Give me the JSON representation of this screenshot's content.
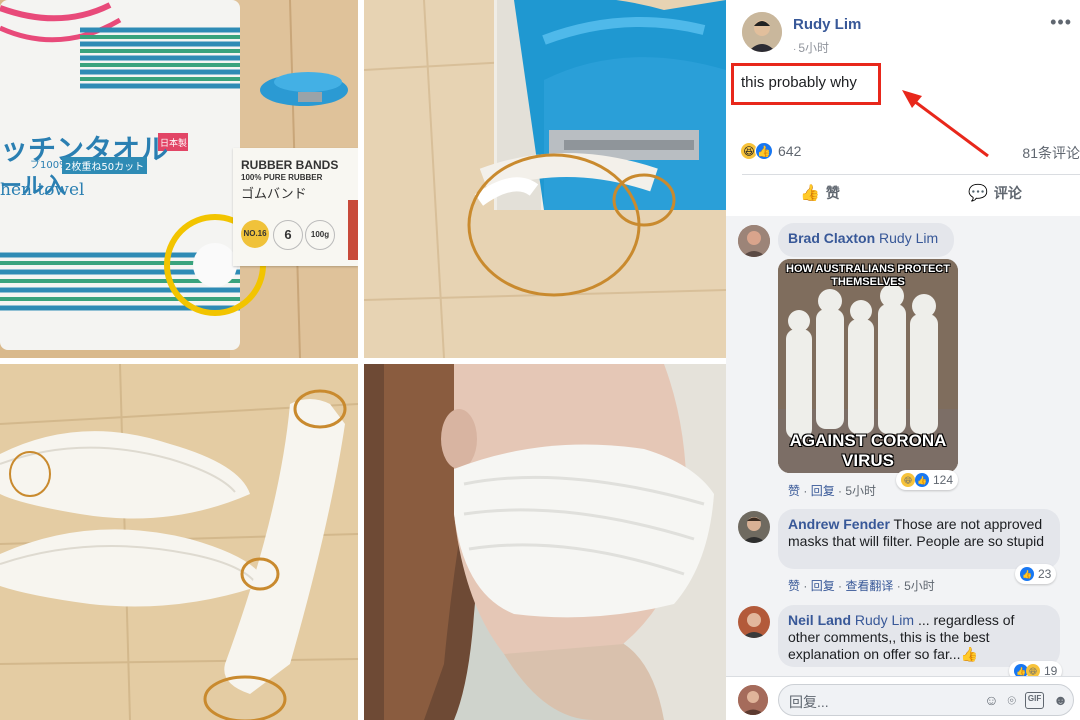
{
  "collage": {
    "panel1": {
      "towel_jp_title": "ッチンタオル",
      "towel_jp_sub": "ール入",
      "towel_en": "hen towel",
      "towel_pack_line1": "ブ100%",
      "towel_pack_line2": "2枚重ね50カット",
      "towel_badge": "日本製",
      "bands_title": "RUBBER BANDS",
      "bands_sub": "100% PURE RUBBER",
      "bands_jp": "ゴムバンド",
      "bands_no": "NO.16",
      "bands_len": "6",
      "bands_weight": "100g"
    },
    "panel4": {}
  },
  "post": {
    "author": "Rudy Lim",
    "time": "5小时",
    "text": "this probably why",
    "reaction_count": "642",
    "comment_count": "81条评论",
    "like_label": "赞",
    "comment_label": "评论"
  },
  "comments": [
    {
      "name": "Brad Claxton",
      "tag": "Rudy Lim",
      "meme_top": "HOW AUSTRALIANS PROTECT THEMSELVES",
      "meme_bottom": "AGAINST CORONA VIRUS",
      "like": "赞",
      "reply": "回复",
      "time": "5小时",
      "reactions": "124"
    },
    {
      "name": "Andrew Fender",
      "text": "Those are not approved masks that will filter. People are so stupid",
      "like": "赞",
      "reply": "回复",
      "translate": "查看翻译",
      "time": "5小时",
      "reactions": "23"
    },
    {
      "name": "Neil Land",
      "tag": "Rudy Lim",
      "text": "... regardless of other comments,, this is the best explanation on offer so far...👍",
      "reactions": "19"
    }
  ],
  "composer": {
    "placeholder": "回复..."
  }
}
